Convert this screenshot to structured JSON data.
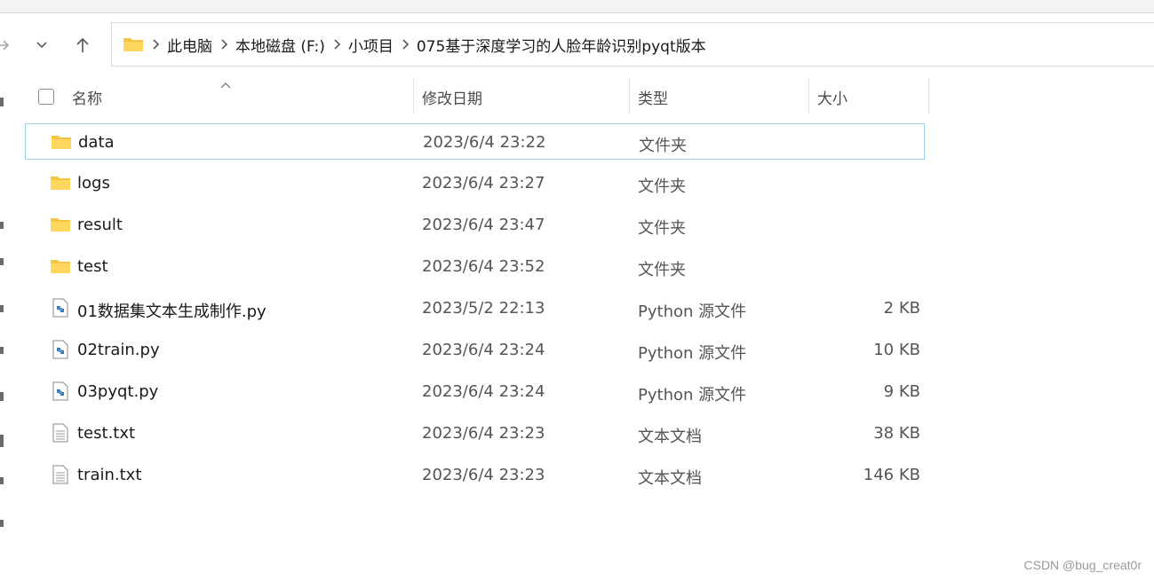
{
  "navigation": {
    "forward_icon": "arrow-right-icon",
    "recent_icon": "chevron-down-icon",
    "up_icon": "arrow-up-icon"
  },
  "address": {
    "folder_icon": "folder-icon",
    "crumbs": [
      "此电脑",
      "本地磁盘 (F:)",
      "小项目",
      "075基于深度学习的人脸年龄识别pyqt版本"
    ]
  },
  "columns": {
    "name": "名称",
    "modified": "修改日期",
    "type": "类型",
    "size": "大小"
  },
  "files": [
    {
      "name": "data",
      "modified": "2023/6/4 23:22",
      "type": "文件夹",
      "size": "",
      "icon": "folder-icon",
      "selected": true
    },
    {
      "name": "logs",
      "modified": "2023/6/4 23:27",
      "type": "文件夹",
      "size": "",
      "icon": "folder-icon"
    },
    {
      "name": "result",
      "modified": "2023/6/4 23:47",
      "type": "文件夹",
      "size": "",
      "icon": "folder-icon"
    },
    {
      "name": "test",
      "modified": "2023/6/4 23:52",
      "type": "文件夹",
      "size": "",
      "icon": "folder-icon"
    },
    {
      "name": "01数据集文本生成制作.py",
      "modified": "2023/5/2 22:13",
      "type": "Python 源文件",
      "size": "2 KB",
      "icon": "python-file-icon"
    },
    {
      "name": "02train.py",
      "modified": "2023/6/4 23:24",
      "type": "Python 源文件",
      "size": "10 KB",
      "icon": "python-file-icon"
    },
    {
      "name": "03pyqt.py",
      "modified": "2023/6/4 23:24",
      "type": "Python 源文件",
      "size": "9 KB",
      "icon": "python-file-icon"
    },
    {
      "name": "test.txt",
      "modified": "2023/6/4 23:23",
      "type": "文本文档",
      "size": "38 KB",
      "icon": "text-file-icon"
    },
    {
      "name": "train.txt",
      "modified": "2023/6/4 23:23",
      "type": "文本文档",
      "size": "146 KB",
      "icon": "text-file-icon"
    }
  ],
  "watermark": "CSDN @bug_creat0r",
  "colors": {
    "selection_border": "#9fd0ec",
    "folder_yellow": "#f4c542",
    "python_blue": "#3d7ab8"
  }
}
